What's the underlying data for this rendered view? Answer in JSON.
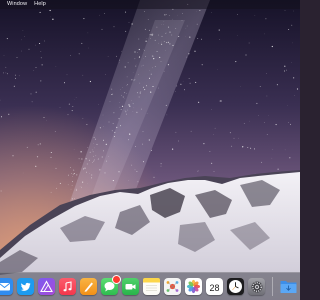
{
  "menubar": {
    "items": [
      {
        "label": "Window"
      },
      {
        "label": "Help"
      }
    ]
  },
  "dock": {
    "items": [
      {
        "name": "mail",
        "icon": "mail-icon",
        "color": "#2f8cf0"
      },
      {
        "name": "twitter",
        "icon": "twitter-bird-icon",
        "color": "#1d9bf0"
      },
      {
        "name": "affinity",
        "icon": "affinity-triangle-icon",
        "color": "#6b4ad6"
      },
      {
        "name": "music",
        "icon": "music-note-icon",
        "color": "#fb4a5e"
      },
      {
        "name": "pages",
        "icon": "pen-icon",
        "color": "#f5a623"
      },
      {
        "name": "messages",
        "icon": "speech-bubble-icon",
        "color": "#36c759",
        "badge": true
      },
      {
        "name": "facetime",
        "icon": "video-camera-icon",
        "color": "#32c35a"
      },
      {
        "name": "notes",
        "icon": "notes-icon",
        "color": "#fcd64a"
      },
      {
        "name": "mindnode",
        "icon": "mindmap-icon",
        "color": "#f4f4f4"
      },
      {
        "name": "photos",
        "icon": "photos-flower-icon",
        "color": "#ffffff"
      },
      {
        "name": "calendar",
        "icon": "calendar-icon",
        "color": "#ffffff",
        "day": "28"
      },
      {
        "name": "clock",
        "icon": "clock-icon",
        "color": "#1c1c1e"
      },
      {
        "name": "system-preferences",
        "icon": "gear-icon",
        "color": "#8e8e93"
      },
      {
        "name": "downloads-folder",
        "icon": "folder-download-icon",
        "color": "#3d8ee8"
      }
    ]
  },
  "colors": {
    "sky_top": "#1c1530",
    "sky_mid": "#4a3a63",
    "horizon": "#c9897a",
    "mountain_shadow": "#3b3646",
    "snow": "#ebe9f0"
  }
}
